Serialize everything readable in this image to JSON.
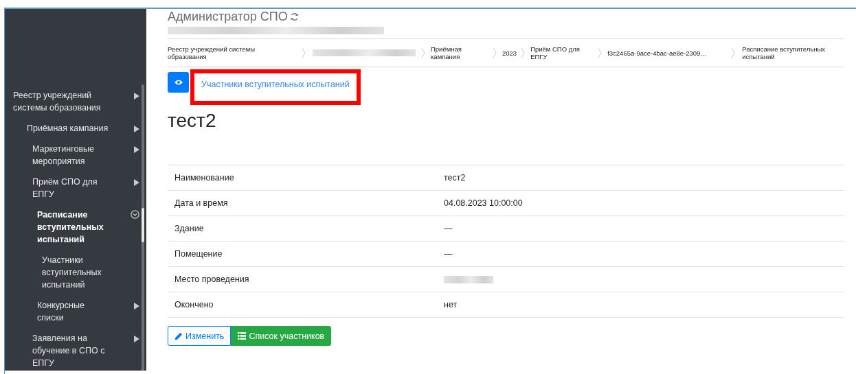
{
  "header": {
    "title": "Администратор СПО",
    "subtitle_blurred": true
  },
  "breadcrumbs": [
    {
      "label": "Реестр учреждений системы образования"
    },
    {
      "blurred": true
    },
    {
      "label": "Приёмная кампания"
    },
    {
      "label": "2023"
    },
    {
      "label": "Приём СПО для ЕПГУ"
    },
    {
      "label": "f3c2465a-9ace-4bac-ae8e-2309…"
    },
    {
      "label": "Расписание вступительных испытаний"
    }
  ],
  "sidebar": {
    "items": [
      {
        "label": "Реестр учреждений системы образования",
        "kind": "collapsed",
        "selected": false,
        "children": [
          {
            "label": "Приёмная кампания",
            "kind": "collapsed",
            "selected": false,
            "children": [
              {
                "label": "Маркетинговые мероприятия",
                "kind": "collapsed",
                "selected": false
              },
              {
                "label": "Приём СПО для ЕПГУ",
                "kind": "collapsed",
                "selected": false,
                "children": [
                  {
                    "label": "Расписание вступительных испытаний",
                    "kind": "expanded",
                    "selected": true,
                    "children": [
                      {
                        "label": "Участники вступительных испытаний",
                        "selected": false
                      }
                    ]
                  },
                  {
                    "label": "Конкурсные списки",
                    "kind": "collapsed",
                    "selected": false
                  }
                ]
              },
              {
                "label": "Заявления на обучение в СПО с ЕПГУ",
                "kind": "collapsed",
                "selected": false
              }
            ]
          }
        ]
      }
    ]
  },
  "tab_link": {
    "label": "Участники вступительных испытаний",
    "highlighted": true
  },
  "record": {
    "title": "тест2",
    "fields": [
      {
        "label": "Наименование",
        "value": "тест2"
      },
      {
        "label": "Дата и время",
        "value": "04.08.2023 10:00:00"
      },
      {
        "label": "Здание",
        "value": "—"
      },
      {
        "label": "Помещение",
        "value": "—"
      },
      {
        "label": "Место проведения",
        "blurred": true
      },
      {
        "label": "Окончено",
        "value": "нет"
      }
    ]
  },
  "buttons": [
    {
      "label": "Изменить",
      "kind": "edit"
    },
    {
      "label": "Список участников",
      "kind": "list"
    }
  ]
}
